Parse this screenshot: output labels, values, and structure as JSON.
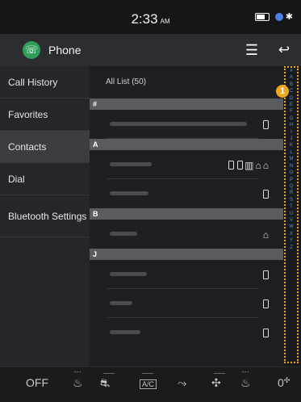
{
  "status": {
    "time": "2:33",
    "ampm": "AM"
  },
  "app": {
    "title": "Phone"
  },
  "sidebar": {
    "items": [
      {
        "label": "Call History"
      },
      {
        "label": "Favorites"
      },
      {
        "label": "Contacts"
      },
      {
        "label": "Dial"
      },
      {
        "label": "Bluetooth Settings"
      }
    ]
  },
  "list": {
    "header": "All List (50)",
    "sections": [
      {
        "letter": "#"
      },
      {
        "letter": "A"
      },
      {
        "letter": "B"
      },
      {
        "letter": "J"
      }
    ]
  },
  "index_letters": [
    "#",
    "A",
    "B",
    "C",
    "D",
    "E",
    "F",
    "G",
    "H",
    "I",
    "J",
    "K",
    "L",
    "M",
    "N",
    "O",
    "P",
    "Q",
    "R",
    "S",
    "T",
    "U",
    "V",
    "W",
    "X",
    "Y",
    "Z"
  ],
  "badge": {
    "number": "1"
  },
  "bottom": {
    "off_label": "OFF",
    "ac_label": "A/C",
    "temp_label": "0"
  },
  "colors": {
    "accent_callout": "#f0a81a",
    "index_letters": "#5b8ed6",
    "app_icon": "#2f9e5b"
  }
}
